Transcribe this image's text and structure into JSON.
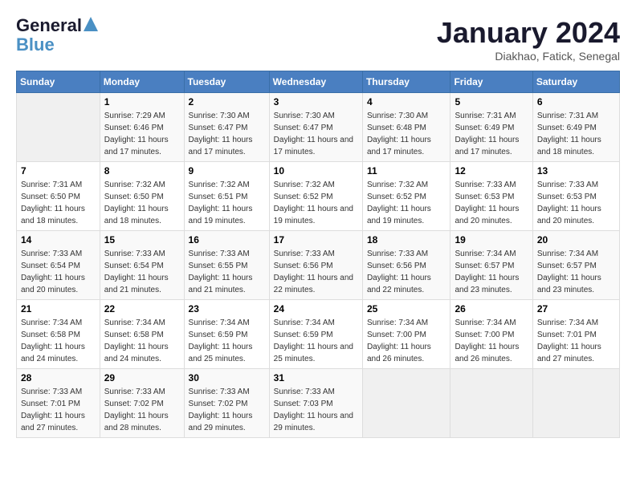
{
  "logo": {
    "line1": "General",
    "line2": "Blue"
  },
  "title": "January 2024",
  "location": "Diakhao, Fatick, Senegal",
  "weekdays": [
    "Sunday",
    "Monday",
    "Tuesday",
    "Wednesday",
    "Thursday",
    "Friday",
    "Saturday"
  ],
  "weeks": [
    [
      {
        "day": null
      },
      {
        "day": "1",
        "sunrise": "7:29 AM",
        "sunset": "6:46 PM",
        "daylight": "11 hours and 17 minutes."
      },
      {
        "day": "2",
        "sunrise": "7:30 AM",
        "sunset": "6:47 PM",
        "daylight": "11 hours and 17 minutes."
      },
      {
        "day": "3",
        "sunrise": "7:30 AM",
        "sunset": "6:47 PM",
        "daylight": "11 hours and 17 minutes."
      },
      {
        "day": "4",
        "sunrise": "7:30 AM",
        "sunset": "6:48 PM",
        "daylight": "11 hours and 17 minutes."
      },
      {
        "day": "5",
        "sunrise": "7:31 AM",
        "sunset": "6:49 PM",
        "daylight": "11 hours and 17 minutes."
      },
      {
        "day": "6",
        "sunrise": "7:31 AM",
        "sunset": "6:49 PM",
        "daylight": "11 hours and 18 minutes."
      }
    ],
    [
      {
        "day": "7",
        "sunrise": "7:31 AM",
        "sunset": "6:50 PM",
        "daylight": "11 hours and 18 minutes."
      },
      {
        "day": "8",
        "sunrise": "7:32 AM",
        "sunset": "6:50 PM",
        "daylight": "11 hours and 18 minutes."
      },
      {
        "day": "9",
        "sunrise": "7:32 AM",
        "sunset": "6:51 PM",
        "daylight": "11 hours and 19 minutes."
      },
      {
        "day": "10",
        "sunrise": "7:32 AM",
        "sunset": "6:52 PM",
        "daylight": "11 hours and 19 minutes."
      },
      {
        "day": "11",
        "sunrise": "7:32 AM",
        "sunset": "6:52 PM",
        "daylight": "11 hours and 19 minutes."
      },
      {
        "day": "12",
        "sunrise": "7:33 AM",
        "sunset": "6:53 PM",
        "daylight": "11 hours and 20 minutes."
      },
      {
        "day": "13",
        "sunrise": "7:33 AM",
        "sunset": "6:53 PM",
        "daylight": "11 hours and 20 minutes."
      }
    ],
    [
      {
        "day": "14",
        "sunrise": "7:33 AM",
        "sunset": "6:54 PM",
        "daylight": "11 hours and 20 minutes."
      },
      {
        "day": "15",
        "sunrise": "7:33 AM",
        "sunset": "6:54 PM",
        "daylight": "11 hours and 21 minutes."
      },
      {
        "day": "16",
        "sunrise": "7:33 AM",
        "sunset": "6:55 PM",
        "daylight": "11 hours and 21 minutes."
      },
      {
        "day": "17",
        "sunrise": "7:33 AM",
        "sunset": "6:56 PM",
        "daylight": "11 hours and 22 minutes."
      },
      {
        "day": "18",
        "sunrise": "7:33 AM",
        "sunset": "6:56 PM",
        "daylight": "11 hours and 22 minutes."
      },
      {
        "day": "19",
        "sunrise": "7:34 AM",
        "sunset": "6:57 PM",
        "daylight": "11 hours and 23 minutes."
      },
      {
        "day": "20",
        "sunrise": "7:34 AM",
        "sunset": "6:57 PM",
        "daylight": "11 hours and 23 minutes."
      }
    ],
    [
      {
        "day": "21",
        "sunrise": "7:34 AM",
        "sunset": "6:58 PM",
        "daylight": "11 hours and 24 minutes."
      },
      {
        "day": "22",
        "sunrise": "7:34 AM",
        "sunset": "6:58 PM",
        "daylight": "11 hours and 24 minutes."
      },
      {
        "day": "23",
        "sunrise": "7:34 AM",
        "sunset": "6:59 PM",
        "daylight": "11 hours and 25 minutes."
      },
      {
        "day": "24",
        "sunrise": "7:34 AM",
        "sunset": "6:59 PM",
        "daylight": "11 hours and 25 minutes."
      },
      {
        "day": "25",
        "sunrise": "7:34 AM",
        "sunset": "7:00 PM",
        "daylight": "11 hours and 26 minutes."
      },
      {
        "day": "26",
        "sunrise": "7:34 AM",
        "sunset": "7:00 PM",
        "daylight": "11 hours and 26 minutes."
      },
      {
        "day": "27",
        "sunrise": "7:34 AM",
        "sunset": "7:01 PM",
        "daylight": "11 hours and 27 minutes."
      }
    ],
    [
      {
        "day": "28",
        "sunrise": "7:33 AM",
        "sunset": "7:01 PM",
        "daylight": "11 hours and 27 minutes."
      },
      {
        "day": "29",
        "sunrise": "7:33 AM",
        "sunset": "7:02 PM",
        "daylight": "11 hours and 28 minutes."
      },
      {
        "day": "30",
        "sunrise": "7:33 AM",
        "sunset": "7:02 PM",
        "daylight": "11 hours and 29 minutes."
      },
      {
        "day": "31",
        "sunrise": "7:33 AM",
        "sunset": "7:03 PM",
        "daylight": "11 hours and 29 minutes."
      },
      {
        "day": null
      },
      {
        "day": null
      },
      {
        "day": null
      }
    ]
  ],
  "labels": {
    "sunrise": "Sunrise:",
    "sunset": "Sunset:",
    "daylight": "Daylight:"
  }
}
